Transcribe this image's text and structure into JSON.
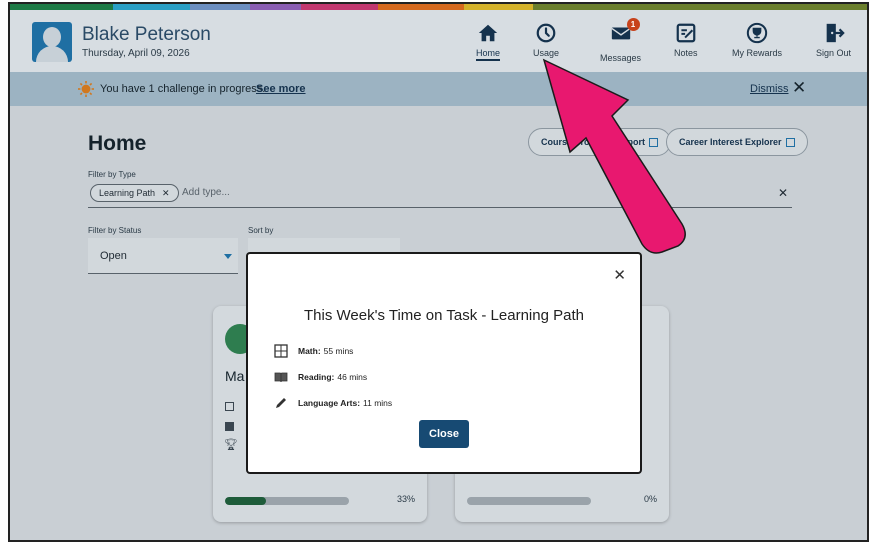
{
  "stripe_colors": [
    "#1e7b46",
    "#2aa0c6",
    "#6c8fc1",
    "#8a5eb3",
    "#c2386f",
    "#d66a1e",
    "#d4b22a",
    "#6b7f2d"
  ],
  "user": {
    "name": "Blake Peterson",
    "date": "Thursday, April 09, 2026"
  },
  "nav": {
    "home": "Home",
    "usage": "Usage",
    "messages": "Messages",
    "messages_badge": "1",
    "notes": "Notes",
    "my_rewards": "My Rewards",
    "sign_out": "Sign Out"
  },
  "banner": {
    "text": "You have 1 challenge in progress.",
    "see_more": "See more",
    "dismiss": "Dismiss"
  },
  "page": {
    "title": "Home",
    "course_report_btn": "Course Progress Report",
    "career_btn": "Career Interest Explorer",
    "filter_type_label": "Filter by Type",
    "chip": "Learning Path",
    "add_type_placeholder": "Add type...",
    "filter_status_label": "Filter by Status",
    "status_value": "Open",
    "sort_label": "Sort by"
  },
  "cards": [
    {
      "title": "Ma",
      "progress_text": "33%",
      "progress_fraction": 0.33
    },
    {
      "title": "",
      "progress_text": "0%",
      "progress_fraction": 0.0
    }
  ],
  "modal": {
    "title": "This Week's Time on Task - Learning Path",
    "rows": [
      {
        "subject": "Math:",
        "value": "55 mins",
        "icon": "calculator-icon"
      },
      {
        "subject": "Reading:",
        "value": "46 mins",
        "icon": "book-icon"
      },
      {
        "subject": "Language Arts:",
        "value": "11 mins",
        "icon": "pencil-icon"
      }
    ],
    "close_label": "Close"
  },
  "annotation_color": "#e8186f"
}
